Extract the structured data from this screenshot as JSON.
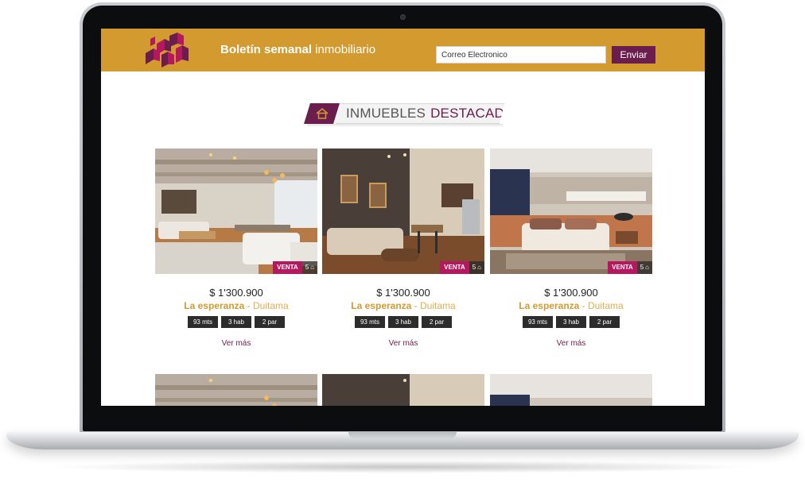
{
  "header": {
    "title_bold": "Boletín semanal",
    "title_light": " inmobiliario",
    "email_placeholder": "Correo Electronico",
    "send_label": "Enviar"
  },
  "section": {
    "title_light": "INMUEBLES",
    "title_strong": "DESTACADOS"
  },
  "listings": [
    {
      "badge": "VENTA",
      "photo_count": "5",
      "price": "$ 1'300.900",
      "neighborhood": "La esperanza",
      "separator": " - ",
      "city": "Duitama",
      "specs": [
        "93 mts",
        "3 hab",
        "2 par"
      ],
      "link": "Ver más"
    },
    {
      "badge": "VENTA",
      "photo_count": "5",
      "price": "$ 1'300.900",
      "neighborhood": "La esperanza",
      "separator": " - ",
      "city": "Duitama",
      "specs": [
        "93 mts",
        "3 hab",
        "2 par"
      ],
      "link": "Ver más"
    },
    {
      "badge": "VENTA",
      "photo_count": "5",
      "price": "$ 1'300.900",
      "neighborhood": "La esperanza",
      "separator": " - ",
      "city": "Duitama",
      "specs": [
        "93 mts",
        "3 hab",
        "2 par"
      ],
      "link": "Ver más"
    }
  ],
  "colors": {
    "brand_gold": "#d39a30",
    "brand_purple": "#6b1d4e",
    "sale_magenta": "#b5185e"
  }
}
